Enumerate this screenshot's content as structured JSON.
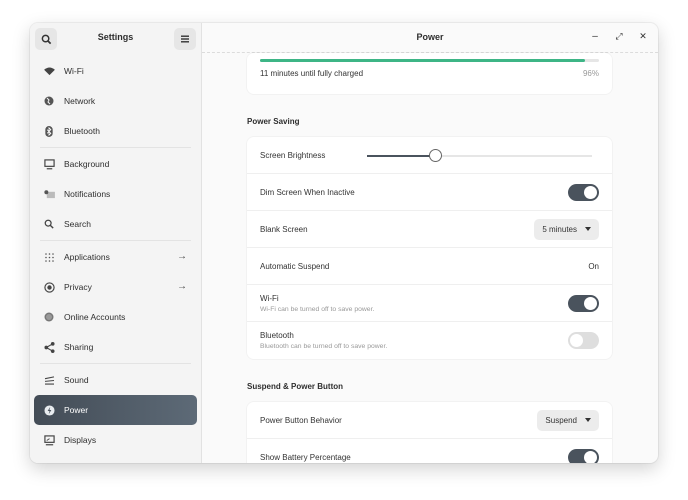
{
  "sidebar": {
    "title": "Settings",
    "search_icon": "search-icon",
    "menu_icon": "hamburger-icon",
    "items": [
      {
        "label": "Wi-Fi",
        "icon": "wifi-icon"
      },
      {
        "label": "Network",
        "icon": "globe-icon"
      },
      {
        "label": "Bluetooth",
        "icon": "bluetooth-icon"
      },
      {
        "label": "Background",
        "icon": "monitor-icon"
      },
      {
        "label": "Notifications",
        "icon": "notifications-icon"
      },
      {
        "label": "Search",
        "icon": "search-icon"
      },
      {
        "label": "Applications",
        "icon": "grid-icon",
        "arrow": "→"
      },
      {
        "label": "Privacy",
        "icon": "privacy-icon",
        "arrow": "→"
      },
      {
        "label": "Online Accounts",
        "icon": "accounts-icon"
      },
      {
        "label": "Sharing",
        "icon": "share-icon"
      },
      {
        "label": "Sound",
        "icon": "sound-icon"
      },
      {
        "label": "Power",
        "icon": "power-icon",
        "active": true
      },
      {
        "label": "Displays",
        "icon": "display-icon"
      }
    ]
  },
  "main": {
    "title": "Power",
    "window_controls": {
      "minimize": "–",
      "maximize": "⤢",
      "close": "✕"
    },
    "battery": {
      "status": "11 minutes until fully charged",
      "percent_label": "96%",
      "percent": 96
    },
    "power_saving": {
      "heading": "Power Saving",
      "screen_brightness": {
        "label": "Screen Brightness",
        "value_percent": 30
      },
      "dim_screen": {
        "label": "Dim Screen When Inactive",
        "on": true
      },
      "blank_screen": {
        "label": "Blank Screen",
        "value": "5 minutes"
      },
      "automatic_suspend": {
        "label": "Automatic Suspend",
        "value": "On"
      },
      "wifi": {
        "label": "Wi-Fi",
        "sub": "Wi-Fi can be turned off to save power.",
        "on": true
      },
      "bluetooth": {
        "label": "Bluetooth",
        "sub": "Bluetooth can be turned off to save power.",
        "on": false
      }
    },
    "suspend_power": {
      "heading": "Suspend & Power Button",
      "power_button_behavior": {
        "label": "Power Button Behavior",
        "value": "Suspend"
      },
      "show_battery_percentage": {
        "label": "Show Battery Percentage",
        "on": true
      }
    }
  },
  "colors": {
    "accent_active": "#4a535d",
    "battery_bar": "#3db586"
  }
}
